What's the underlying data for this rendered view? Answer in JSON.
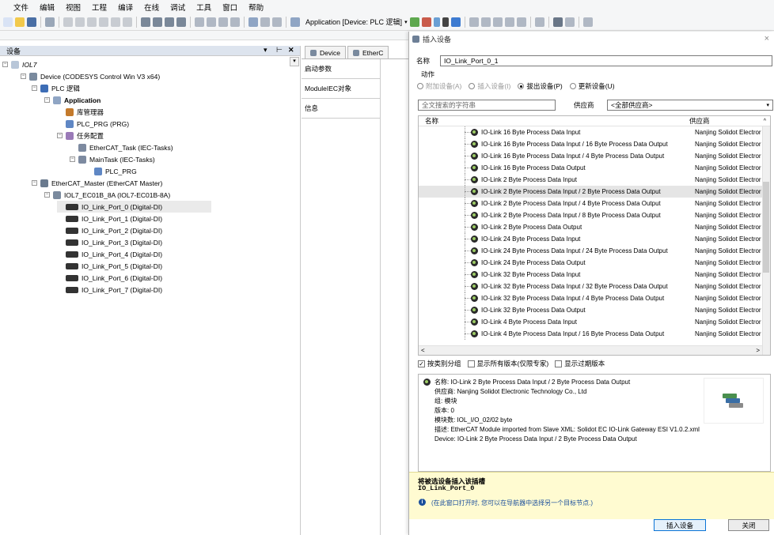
{
  "menu": [
    "文件",
    "编辑",
    "视图",
    "工程",
    "编译",
    "在线",
    "调试",
    "工具",
    "窗口",
    "帮助"
  ],
  "toolbar": {
    "app_label": "Application [Device: PLC 逻辑]"
  },
  "devices_panel": {
    "title": "设备",
    "controls": [
      "▾",
      "⊢",
      "✕"
    ],
    "tree": [
      {
        "label": "IOL7",
        "italic": true,
        "level": 0,
        "toggle": "−",
        "icon": "project-icon"
      },
      {
        "label": "Device (CODESYS Control Win V3 x64)",
        "level": 1,
        "toggle": "−",
        "icon": "device-icon"
      },
      {
        "label": "PLC 逻辑",
        "level": 2,
        "toggle": "−",
        "icon": "plc-logic-icon"
      },
      {
        "label": "Application",
        "bold": true,
        "level": 3,
        "toggle": "−",
        "icon": "application-icon"
      },
      {
        "label": "库管理器",
        "level": 4,
        "icon": "library-manager-icon"
      },
      {
        "label": "PLC_PRG (PRG)",
        "level": 4,
        "icon": "program-icon"
      },
      {
        "label": "任务配置",
        "level": 4,
        "toggle": "−",
        "icon": "task-config-icon"
      },
      {
        "label": "EtherCAT_Task (IEC-Tasks)",
        "level": 5,
        "icon": "task-icon"
      },
      {
        "label": "MainTask (IEC-Tasks)",
        "level": 5,
        "toggle": "−",
        "icon": "task-icon"
      },
      {
        "label": "PLC_PRG",
        "level": 6,
        "icon": "program-call-icon"
      },
      {
        "label": "EtherCAT_Master (EtherCAT Master)",
        "level": 2,
        "toggle": "−",
        "icon": "ethercat-master-icon"
      },
      {
        "label": "IOL7_EC01B_8A (IOL7-EC01B-8A)",
        "level": 3,
        "toggle": "−",
        "icon": "slave-device-icon"
      },
      {
        "label": "IO_Link_Port_0 (Digital-DI)",
        "level": 4,
        "icon": "io-port-icon",
        "selected": true
      },
      {
        "label": "IO_Link_Port_1 (Digital-DI)",
        "level": 4,
        "icon": "io-port-icon"
      },
      {
        "label": "IO_Link_Port_2 (Digital-DI)",
        "level": 4,
        "icon": "io-port-icon"
      },
      {
        "label": "IO_Link_Port_3 (Digital-DI)",
        "level": 4,
        "icon": "io-port-icon"
      },
      {
        "label": "IO_Link_Port_4 (Digital-DI)",
        "level": 4,
        "icon": "io-port-icon"
      },
      {
        "label": "IO_Link_Port_5 (Digital-DI)",
        "level": 4,
        "icon": "io-port-icon"
      },
      {
        "label": "IO_Link_Port_6 (Digital-DI)",
        "level": 4,
        "icon": "io-port-icon"
      },
      {
        "label": "IO_Link_Port_7 (Digital-DI)",
        "level": 4,
        "icon": "io-port-icon"
      }
    ]
  },
  "editor": {
    "tabs": [
      "Device",
      "EtherC"
    ],
    "side_items": [
      "启动参数",
      "ModuleIEC对象",
      "信息"
    ]
  },
  "dialog": {
    "title": "插入设备",
    "name_label": "名称",
    "name_value": "IO_Link_Port_0_1",
    "action_label": "动作",
    "actions": [
      {
        "label": "附加设备(A)",
        "enabled": false,
        "checked": false
      },
      {
        "label": "插入设备(I)",
        "enabled": false,
        "checked": false
      },
      {
        "label": "拔出设备(P)",
        "enabled": true,
        "checked": true
      },
      {
        "label": "更新设备(U)",
        "enabled": true,
        "checked": false
      }
    ],
    "search_placeholder": "全文搜索的字符串",
    "vendor_label": "供应商",
    "vendor_value": "<全部供应商>",
    "col_name": "名称",
    "col_vendor": "供应商",
    "rows": [
      {
        "name": "IO-Link 16 Byte Process Data Input",
        "vendor": "Nanjing Solidot Electror"
      },
      {
        "name": "IO-Link 16 Byte Process Data Input / 16 Byte Process Data Output",
        "vendor": "Nanjing Solidot Electror"
      },
      {
        "name": "IO-Link 16 Byte Process Data Input / 4 Byte Process Data Output",
        "vendor": "Nanjing Solidot Electror"
      },
      {
        "name": "IO-Link 16 Byte Process Data Output",
        "vendor": "Nanjing Solidot Electror"
      },
      {
        "name": "IO-Link 2 Byte Process Data Input",
        "vendor": "Nanjing Solidot Electror"
      },
      {
        "name": "IO-Link 2 Byte Process Data Input / 2 Byte Process Data Output",
        "vendor": "Nanjing Solidot Electror",
        "selected": true
      },
      {
        "name": "IO-Link 2 Byte Process Data Input / 4 Byte Process Data Output",
        "vendor": "Nanjing Solidot Electror"
      },
      {
        "name": "IO-Link 2 Byte Process Data Input / 8 Byte Process Data Output",
        "vendor": "Nanjing Solidot Electror"
      },
      {
        "name": "IO-Link 2 Byte Process Data Output",
        "vendor": "Nanjing Solidot Electror"
      },
      {
        "name": "IO-Link 24 Byte Process Data Input",
        "vendor": "Nanjing Solidot Electror"
      },
      {
        "name": "IO-Link 24 Byte Process Data Input / 24 Byte Process Data Output",
        "vendor": "Nanjing Solidot Electror"
      },
      {
        "name": "IO-Link 24 Byte Process Data Output",
        "vendor": "Nanjing Solidot Electror"
      },
      {
        "name": "IO-Link 32 Byte Process Data Input",
        "vendor": "Nanjing Solidot Electror"
      },
      {
        "name": "IO-Link 32 Byte Process Data Input / 32 Byte Process Data Output",
        "vendor": "Nanjing Solidot Electror"
      },
      {
        "name": "IO-Link 32 Byte Process Data Input / 4 Byte Process Data Output",
        "vendor": "Nanjing Solidot Electror"
      },
      {
        "name": "IO-Link 32 Byte Process Data Output",
        "vendor": "Nanjing Solidot Electror"
      },
      {
        "name": "IO-Link 4 Byte Process Data Input",
        "vendor": "Nanjing Solidot Electror"
      },
      {
        "name": "IO-Link 4 Byte Process Data Input / 16 Byte Process Data Output",
        "vendor": "Nanjing Solidot Electror"
      }
    ],
    "options": [
      {
        "label": "按类别分组",
        "checked": true
      },
      {
        "label": "显示所有版本(仅限专家)",
        "checked": false
      },
      {
        "label": "显示过期版本",
        "checked": false
      }
    ],
    "details": {
      "name": "名称: IO-Link 2 Byte Process Data Input / 2 Byte Process Data Output",
      "vendor": "供应商: Nanjing Solidot Electronic Technology Co., Ltd",
      "group": "组: 模块",
      "version": "版本: 0",
      "model": "模块数: IOL_I/O_02/02 byte",
      "description": "描述: EtherCAT Module imported from Slave XML: Solidot EC IO-Link Gateway ESI V1.0.2.xml Device: IO-Link 2 Byte Process Data Input / 2 Byte Process Data Output"
    },
    "insert_title": "将被选设备插入该插槽",
    "insert_target": "IO_Link_Port_0",
    "insert_hint": "(在此窗口打开时, 您可以在导航器中选择另一个目标节点.)",
    "insert_button": "插入设备",
    "close_button": "关闭"
  },
  "colors": {
    "accent": "#0b74d6",
    "selection": "#e5e5e5",
    "hint_bg": "#fffbd1"
  }
}
